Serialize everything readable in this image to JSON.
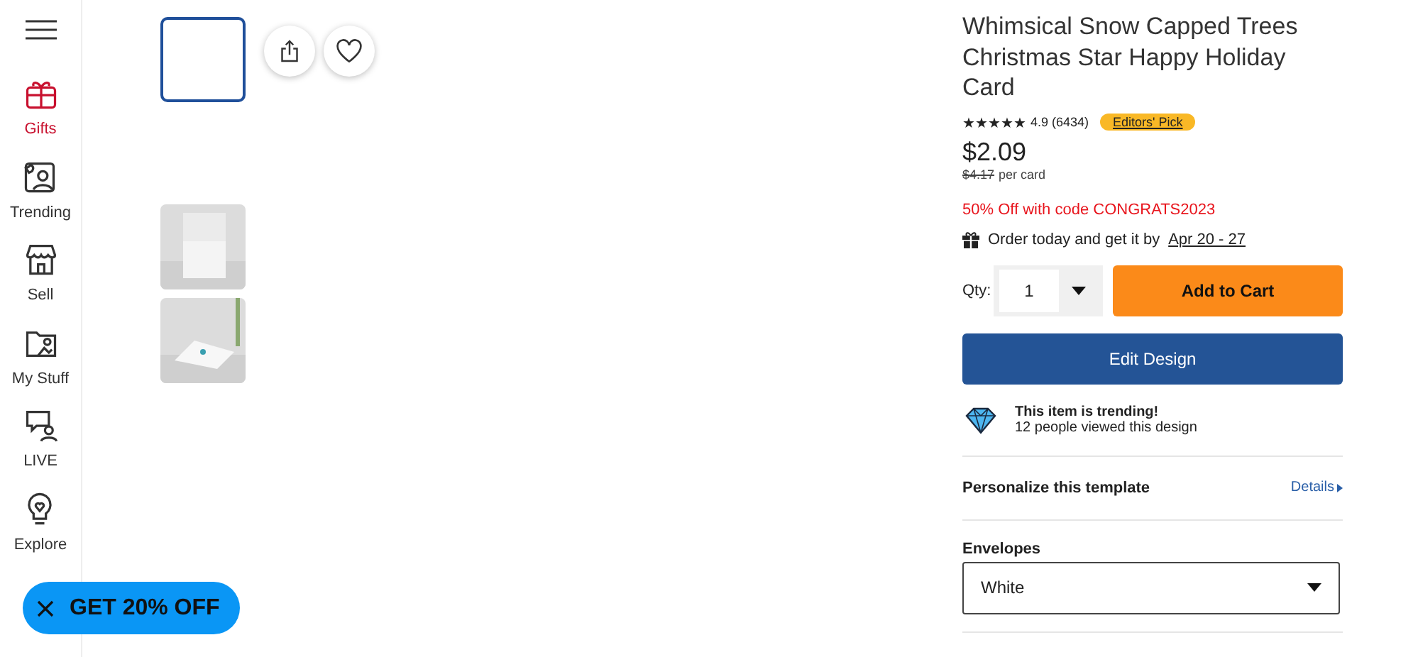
{
  "sidebar": {
    "items": [
      {
        "label": "Gifts",
        "selected": true
      },
      {
        "label": "Trending",
        "selected": false
      },
      {
        "label": "Sell",
        "selected": false
      },
      {
        "label": "My Stuff",
        "selected": false
      },
      {
        "label": "LIVE",
        "selected": false
      },
      {
        "label": "Explore",
        "selected": false
      }
    ]
  },
  "gallery": {
    "thumbnails": [
      {
        "kind": "blank",
        "selected": true
      },
      {
        "kind": "picture",
        "selected": false
      },
      {
        "kind": "picture",
        "selected": false
      }
    ]
  },
  "promo_button": {
    "label": "GET 20% OFF"
  },
  "product": {
    "title": "Whimsical Snow Capped Trees Christmas Star Happy Holiday Card",
    "stars": 5,
    "rating": "4.9 (6434)",
    "badge": "Editors' Pick",
    "price": "$2.09",
    "old_price": "$4.17",
    "unit": "per card",
    "promo": "50% Off with code CONGRATS2023",
    "delivery": {
      "text": "Order today and get it by",
      "date": "Apr 20 - 27"
    },
    "qty_label": "Qty:",
    "qty": "1",
    "add_to_cart": "Add to Cart",
    "edit_design": "Edit Design",
    "trending": {
      "title": "This item is trending!",
      "subtitle": "12 people viewed this design"
    },
    "personalize": {
      "label": "Personalize this template",
      "link": "Details"
    },
    "envelopes": {
      "label": "Envelopes",
      "value": "White"
    }
  }
}
